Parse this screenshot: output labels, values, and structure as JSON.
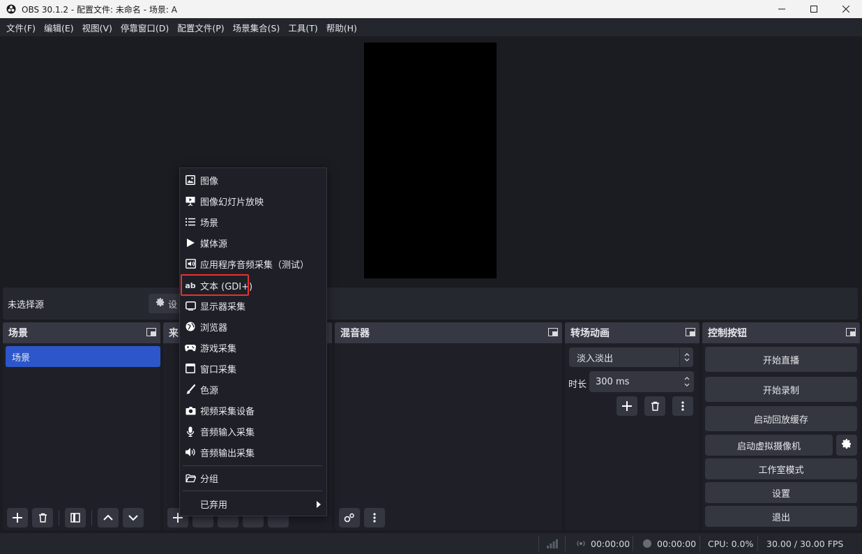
{
  "window": {
    "title": "OBS 30.1.2 - 配置文件: 未命名 - 场景: A"
  },
  "menubar": {
    "items": [
      "文件(F)",
      "编辑(E)",
      "视图(V)",
      "停靠窗口(D)",
      "配置文件(P)",
      "场景集合(S)",
      "工具(T)",
      "帮助(H)"
    ]
  },
  "source_bar": {
    "no_source": "未选择源",
    "properties_label": "设"
  },
  "docks": {
    "scenes": {
      "title": "场景",
      "items": [
        "场景"
      ]
    },
    "sources": {
      "title": "来"
    },
    "mixer": {
      "title": "混音器"
    },
    "transitions": {
      "title": "转场动画",
      "selected": "淡入淡出",
      "duration_label": "时长",
      "duration_value": "300 ms"
    },
    "controls": {
      "title": "控制按钮",
      "buttons": [
        "开始直播",
        "开始录制",
        "启动回放缓存",
        "启动虚拟摄像机",
        "工作室模式",
        "设置",
        "退出"
      ]
    }
  },
  "context_menu": {
    "items": [
      {
        "label": "图像",
        "icon": "image-icon"
      },
      {
        "label": "图像幻灯片放映",
        "icon": "slideshow-icon"
      },
      {
        "label": "场景",
        "icon": "list-icon"
      },
      {
        "label": "媒体源",
        "icon": "play-icon"
      },
      {
        "label": "应用程序音频采集（测试）",
        "icon": "app-audio-icon"
      },
      {
        "label": "文本 (GDI+)",
        "icon": "text-icon",
        "glyph": "ab"
      },
      {
        "label": "显示器采集",
        "icon": "monitor-icon"
      },
      {
        "label": "浏览器",
        "icon": "globe-icon"
      },
      {
        "label": "游戏采集",
        "icon": "gamepad-icon"
      },
      {
        "label": "窗口采集",
        "icon": "window-icon"
      },
      {
        "label": "色源",
        "icon": "brush-icon"
      },
      {
        "label": "视频采集设备",
        "icon": "camera-icon"
      },
      {
        "label": "音频输入采集",
        "icon": "microphone-icon"
      },
      {
        "label": "音频输出采集",
        "icon": "speaker-icon"
      },
      {
        "label": "分组",
        "icon": "folder-icon"
      },
      {
        "label": "已弃用",
        "icon": "chevron-right-icon"
      }
    ],
    "highlighted_index": 5
  },
  "status_bar": {
    "stream_time": "00:00:00",
    "record_time": "00:00:00",
    "cpu": "CPU: 0.0%",
    "fps": "30.00 / 30.00 FPS"
  },
  "colors": {
    "accent": "#2c56c9",
    "highlight_border": "#e8312f"
  }
}
